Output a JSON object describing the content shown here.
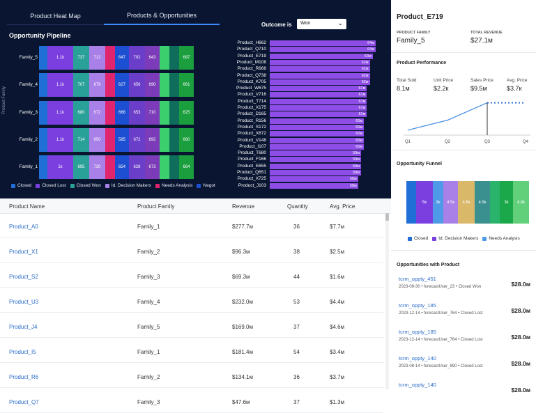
{
  "tabs": [
    {
      "label": "Product Heat Map"
    },
    {
      "label": "Products & Opportunities"
    }
  ],
  "pipeline": {
    "title": "Opportunity Pipeline",
    "y_axis_label": "Product Family",
    "rows": [
      {
        "family": "Family_5",
        "cells": [
          "",
          "1.1k",
          "737",
          "712",
          "",
          "647",
          "702",
          "643",
          "",
          "",
          "687"
        ]
      },
      {
        "family": "Family_4",
        "cells": [
          "",
          "1.1k",
          "707",
          "679",
          "",
          "627",
          "656",
          "690",
          "",
          "",
          "661"
        ]
      },
      {
        "family": "Family_3",
        "cells": [
          "",
          "1.1k",
          "680",
          "672",
          "",
          "666",
          "653",
          "710",
          "",
          "",
          "625"
        ]
      },
      {
        "family": "Family_2",
        "cells": [
          "",
          "1.1k",
          "714",
          "650",
          "",
          "585",
          "672",
          "692",
          "",
          "",
          "660"
        ]
      },
      {
        "family": "Family_1",
        "cells": [
          "",
          "1k",
          "695",
          "730",
          "",
          "654",
          "628",
          "673",
          "",
          "",
          "664"
        ]
      }
    ],
    "legend": [
      {
        "label": "Closed",
        "color": "#1f6fd6"
      },
      {
        "label": "Closed Lost",
        "color": "#7b3fe0"
      },
      {
        "label": "Closed Won",
        "color": "#2aa198"
      },
      {
        "label": "Id. Decision Makers",
        "color": "#a97fe8"
      },
      {
        "label": "Needs Analysis",
        "color": "#e0256e"
      },
      {
        "label": "Negot",
        "color": "#1c4fd1"
      }
    ]
  },
  "outcome": {
    "label": "Outcome is",
    "value": "Won"
  },
  "top_products": [
    {
      "name": "Product_H662",
      "value": "64м"
    },
    {
      "name": "Product_Q710",
      "value": "64м"
    },
    {
      "name": "Product_E719",
      "value": "63м"
    },
    {
      "name": "Product_M108",
      "value": "62м"
    },
    {
      "name": "Product_R668",
      "value": "62м"
    },
    {
      "name": "Product_Q738",
      "value": "62м"
    },
    {
      "name": "Product_K705",
      "value": "62м"
    },
    {
      "name": "Product_W675",
      "value": "61м"
    },
    {
      "name": "Product_V716",
      "value": "61м"
    },
    {
      "name": "Product_T714",
      "value": "61м"
    },
    {
      "name": "Product_X175",
      "value": "61м"
    },
    {
      "name": "Product_D165",
      "value": "61м"
    },
    {
      "name": "Product_R156",
      "value": "60м"
    },
    {
      "name": "Product_S172",
      "value": "60м"
    },
    {
      "name": "Product_X672",
      "value": "60м"
    },
    {
      "name": "Product_V148",
      "value": "60м"
    },
    {
      "name": "Product_I107",
      "value": "60м"
    },
    {
      "name": "Product_T680",
      "value": "59м"
    },
    {
      "name": "Product_F166",
      "value": "59м"
    },
    {
      "name": "Product_E655",
      "value": "59м"
    },
    {
      "name": "Product_Q651",
      "value": "59м"
    },
    {
      "name": "Product_X725",
      "value": "58м"
    },
    {
      "name": "Product_J103",
      "value": "58м"
    }
  ],
  "table": {
    "headers": [
      "Product Name",
      "Product Family",
      "Revenue",
      "Quantity",
      "Avg. Price"
    ],
    "rows": [
      [
        "Product_A0",
        "Family_1",
        "$277.7м",
        "36",
        "$7.7м"
      ],
      [
        "Product_X1",
        "Family_2",
        "$96.3м",
        "38",
        "$2.5м"
      ],
      [
        "Product_S2",
        "Family_3",
        "$69.3м",
        "44",
        "$1.6м"
      ],
      [
        "Product_U3",
        "Family_4",
        "$232.0м",
        "53",
        "$4.4м"
      ],
      [
        "Product_J4",
        "Family_5",
        "$169.0м",
        "37",
        "$4.6м"
      ],
      [
        "Product_I5",
        "Family_1",
        "$181.4м",
        "54",
        "$3.4м"
      ],
      [
        "Product_R6",
        "Family_2",
        "$134.1м",
        "36",
        "$3.7м"
      ],
      [
        "Product_Q7",
        "Family_3",
        "$47.6м",
        "37",
        "$1.3м"
      ]
    ]
  },
  "detail": {
    "title": "Product_E719",
    "family_label": "PRODUCT FAMILY",
    "family_value": "Family_5",
    "revenue_label": "TOTAL REVENUE",
    "revenue_value": "$27.1м",
    "performance": {
      "title": "Product Performance",
      "metrics": [
        {
          "label": "Total Sold",
          "value": "8.1м"
        },
        {
          "label": "Unit Price",
          "value": "$2.2к"
        },
        {
          "label": "Sales Price",
          "value": "$9.5м"
        },
        {
          "label": "Avg. Price",
          "value": "$3.7к"
        }
      ],
      "chart_data": {
        "type": "line",
        "categories": [
          "Q1",
          "Q2",
          "Q3",
          "Q4"
        ],
        "series": [
          {
            "values": [
              1,
              3,
              6.5,
              6.5
            ]
          }
        ]
      }
    },
    "funnel": {
      "title": "Opportunity Funnel",
      "segments": [
        {
          "label": "",
          "color": "#1f6fd6"
        },
        {
          "label": "5к",
          "color": "#7b3fe0"
        },
        {
          "label": "3к",
          "color": "#4f9ae8"
        },
        {
          "label": "4.5к",
          "color": "#a97fe8"
        },
        {
          "label": "4.8к",
          "color": "#d9b86a"
        },
        {
          "label": "4.9к",
          "color": "#3a8f8f"
        },
        {
          "label": "",
          "color": "#2ab36a"
        },
        {
          "label": "3к",
          "color": "#1aa84a"
        },
        {
          "label": "4.8к",
          "color": "#62d07a"
        }
      ],
      "legend": [
        {
          "label": "Closed",
          "color": "#1f6fd6"
        },
        {
          "label": "Id. Decision Makers",
          "color": "#7b3fe0"
        },
        {
          "label": "Needs Analysis",
          "color": "#4f9ae8"
        }
      ]
    },
    "opportunities": {
      "title": "Opportunities with Product",
      "items": [
        {
          "name": "tcrm_oppty_451",
          "meta": "2023-09-30 • forecastUser_23 • Closed Won",
          "amount": "$28.0м"
        },
        {
          "name": "tcrm_oppty_185",
          "meta": "2023-12-14 • forecastUser_764 • Closed Lost",
          "amount": "$28.0м"
        },
        {
          "name": "tcrm_oppty_185",
          "meta": "2023-12-14 • forecastUser_764 • Closed Lost",
          "amount": "$28.0м"
        },
        {
          "name": "tcrm_oppty_140",
          "meta": "2023-08-14 • forecastUser_890 • Closed Lost",
          "amount": "$28.0м"
        },
        {
          "name": "tcrm_oppty_140",
          "meta": "",
          "amount": "$28.0м"
        }
      ]
    }
  }
}
